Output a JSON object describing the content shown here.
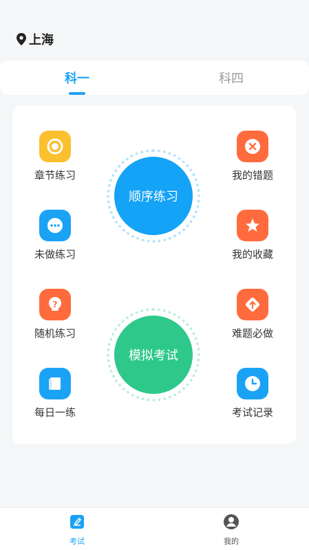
{
  "header": {
    "location": "上海"
  },
  "tabs": [
    {
      "label": "科一",
      "active": true
    },
    {
      "label": "科四",
      "active": false
    }
  ],
  "left_functions": [
    {
      "label": "章节练习",
      "icon": "target-icon",
      "color": "#fbc02d"
    },
    {
      "label": "未做练习",
      "icon": "more-dots-icon",
      "color": "#1aa3f5"
    },
    {
      "label": "随机练习",
      "icon": "question-icon",
      "color": "#ff6b3d"
    },
    {
      "label": "每日一练",
      "icon": "book-icon",
      "color": "#1aa3f5"
    }
  ],
  "right_functions": [
    {
      "label": "我的错题",
      "icon": "close-icon",
      "color": "#ff6b3d"
    },
    {
      "label": "我的收藏",
      "icon": "star-icon",
      "color": "#ff6b3d"
    },
    {
      "label": "难题必做",
      "icon": "arrow-up-icon",
      "color": "#ff6b3d"
    },
    {
      "label": "考试记录",
      "icon": "clock-icon",
      "color": "#1aa3f5"
    }
  ],
  "main_actions": {
    "sequential": "顺序练习",
    "mock_exam": "模拟考试"
  },
  "bottom_nav": [
    {
      "label": "考试",
      "icon": "edit-icon",
      "active": true
    },
    {
      "label": "我的",
      "icon": "user-icon",
      "active": false
    }
  ],
  "colors": {
    "accent": "#1aa3f5",
    "green": "#2ec98a",
    "orange": "#ff6b3d",
    "yellow": "#fbc02d"
  }
}
